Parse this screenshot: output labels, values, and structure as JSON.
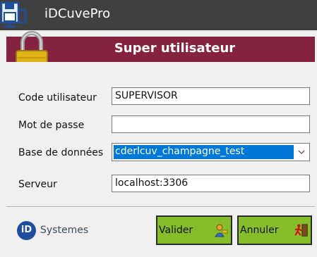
{
  "window": {
    "title": "iDCuvePro"
  },
  "banner": {
    "title": "Super utilisateur"
  },
  "form": {
    "user_code": {
      "label": "Code utilisateur",
      "value": "SUPERVISOR"
    },
    "password": {
      "label": "Mot de passe",
      "value": ""
    },
    "database": {
      "label": "Base de données",
      "value": "cderlcuv_champagne_test"
    },
    "server": {
      "label": "Serveur",
      "value": "localhost:3306"
    }
  },
  "footer": {
    "logo_mark": "iD",
    "logo_name": "Systemes",
    "validate_label": "Valider",
    "cancel_label": "Annuler"
  },
  "icons": {
    "app": "floppy-network-icon",
    "lock": "padlock-icon",
    "validate": "user-key-icon",
    "cancel": "exit-person-icon"
  },
  "colors": {
    "titlebar": "#404040",
    "banner": "#85223f",
    "button": "#86bd2a",
    "selection": "#0078d7",
    "logo": "#1f4e9c"
  }
}
